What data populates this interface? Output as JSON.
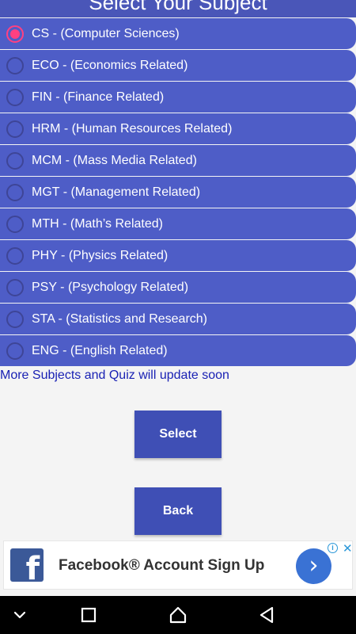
{
  "header": {
    "title": "Select Your Subject"
  },
  "options": [
    {
      "label": "CS - (Computer Sciences)",
      "selected": true
    },
    {
      "label": "ECO - (Economics Related)",
      "selected": false
    },
    {
      "label": "FIN - (Finance Related)",
      "selected": false
    },
    {
      "label": "HRM - (Human Resources Related)",
      "selected": false
    },
    {
      "label": "MCM - (Mass Media Related)",
      "selected": false
    },
    {
      "label": "MGT - (Management Related)",
      "selected": false
    },
    {
      "label": "MTH - (Math’s Related)",
      "selected": false
    },
    {
      "label": "PHY - (Physics Related)",
      "selected": false
    },
    {
      "label": "PSY - (Psychology Related)",
      "selected": false
    },
    {
      "label": "STA - (Statistics and Research)",
      "selected": false
    },
    {
      "label": "ENG - (English Related)",
      "selected": false
    }
  ],
  "notice": "More Subjects and Quiz will update soon",
  "buttons": {
    "select": "Select",
    "back": "Back"
  },
  "ad": {
    "title": "Facebook® Account Sign Up",
    "logo_glyph": "f",
    "adchoices_glyph": "i",
    "close_glyph": "✕",
    "arrow_glyph": "›"
  },
  "navbar": {
    "icons": [
      "chevron-down-icon",
      "recents-icon",
      "home-icon",
      "back-icon"
    ]
  },
  "colors": {
    "option_bg": "#4e5dc7",
    "button_bg": "#3f4fb5",
    "radio_selected": "#ff4081",
    "notice_text": "#1a22b4",
    "facebook_blue": "#3b5998"
  }
}
